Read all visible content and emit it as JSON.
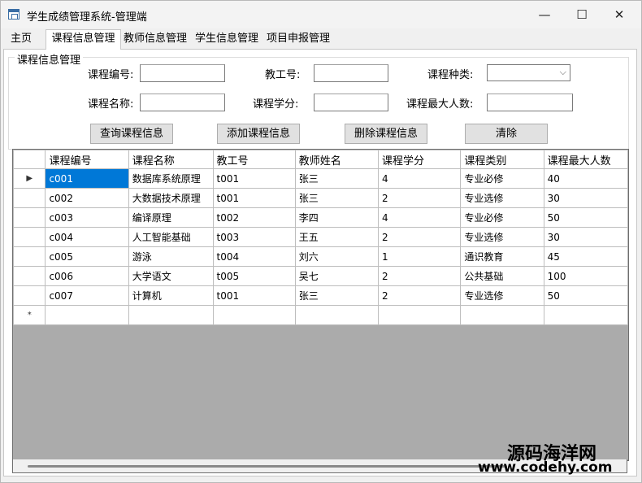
{
  "window": {
    "title": "学生成绩管理系统-管理端",
    "min_icon": "—",
    "max_icon": "☐",
    "close_icon": "✕"
  },
  "tabs": [
    {
      "label": "主页"
    },
    {
      "label": "课程信息管理"
    },
    {
      "label": "教师信息管理"
    },
    {
      "label": "学生信息管理"
    },
    {
      "label": "项目申报管理"
    }
  ],
  "group_title": "课程信息管理",
  "form": {
    "course_id_label": "课程编号:",
    "course_id_value": "",
    "teacher_id_label": "教工号:",
    "teacher_id_value": "",
    "course_type_label": "课程种类:",
    "course_type_value": "",
    "course_name_label": "课程名称:",
    "course_name_value": "",
    "credit_label": "课程学分:",
    "credit_value": "",
    "max_label": "课程最大人数:",
    "max_value": ""
  },
  "buttons": {
    "query": "查询课程信息",
    "add": "添加课程信息",
    "delete": "删除课程信息",
    "clear": "清除"
  },
  "table": {
    "columns": [
      "课程编号",
      "课程名称",
      "教工号",
      "教师姓名",
      "课程学分",
      "课程类别",
      "课程最大人数"
    ],
    "rows": [
      [
        "c001",
        "数据库系统原理",
        "t001",
        "张三",
        "4",
        "专业必修",
        "40"
      ],
      [
        "c002",
        "大数据技术原理",
        "t001",
        "张三",
        "2",
        "专业选修",
        "30"
      ],
      [
        "c003",
        "编译原理",
        "t002",
        "李四",
        "4",
        "专业必修",
        "50"
      ],
      [
        "c004",
        "人工智能基础",
        "t003",
        "王五",
        "2",
        "专业选修",
        "30"
      ],
      [
        "c005",
        "游泳",
        "t004",
        "刘六",
        "1",
        "通识教育",
        "45"
      ],
      [
        "c006",
        "大学语文",
        "t005",
        "吴七",
        "2",
        "公共基础",
        "100"
      ],
      [
        "c007",
        "计算机",
        "t001",
        "张三",
        "2",
        "专业选修",
        "50"
      ]
    ],
    "current_row_marker": "▶",
    "new_row_marker": "*"
  },
  "watermark": {
    "line1": "源码海洋网",
    "line2": "www.codehy.com"
  }
}
